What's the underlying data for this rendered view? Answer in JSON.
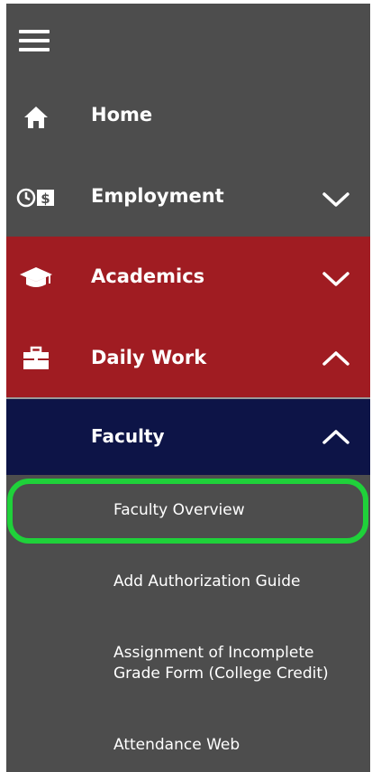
{
  "menu": {
    "hamburger_icon": "hamburger-menu-icon",
    "items": [
      {
        "label": "Home",
        "icon": "home-icon"
      },
      {
        "label": "Employment",
        "icon": "clock-money-icon",
        "expand": "chevron-down-icon"
      },
      {
        "label": "Academics",
        "icon": "graduation-cap-icon",
        "expand": "chevron-down-icon"
      },
      {
        "label": "Daily Work",
        "icon": "briefcase-icon",
        "expand": "chevron-up-icon"
      }
    ],
    "faculty": {
      "label": "Faculty",
      "expand": "chevron-up-icon"
    },
    "sub_items": [
      {
        "label": "Faculty Overview"
      },
      {
        "label": "Add Authorization Guide"
      },
      {
        "label_line1": "Assignment of Incomplete",
        "label_line2": "Grade Form (College Credit)"
      },
      {
        "label": "Attendance Web"
      }
    ]
  },
  "colors": {
    "sidebar_bg": "#4d4d4d",
    "accent_red": "#a01c22",
    "accent_navy": "#0d1447",
    "highlight_green": "#1fd13a"
  }
}
